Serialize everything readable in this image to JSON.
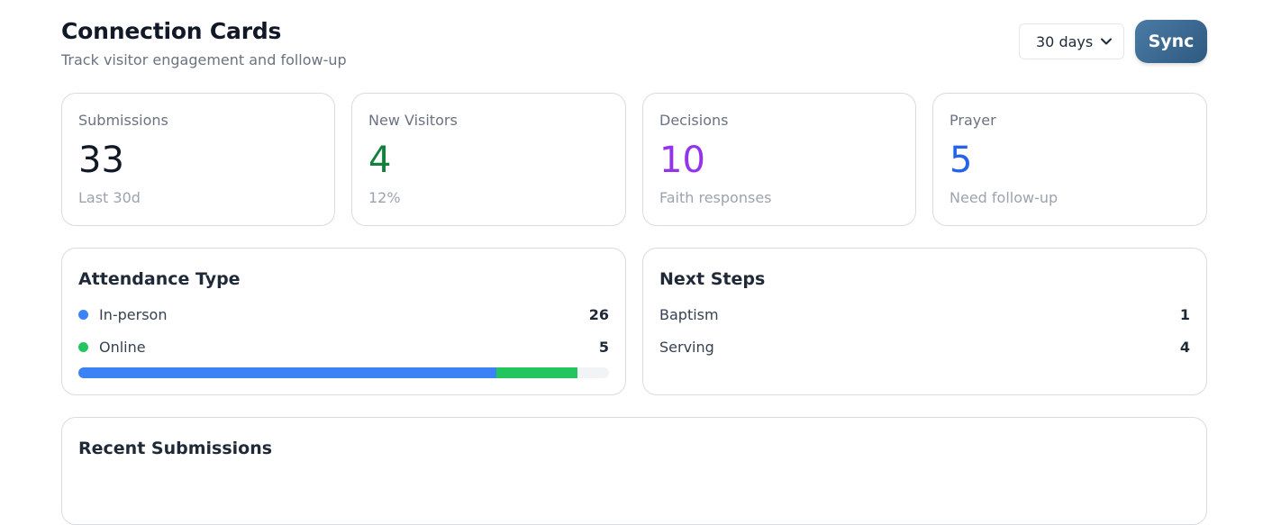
{
  "header": {
    "title": "Connection Cards",
    "subtitle": "Track visitor engagement and follow-up",
    "range_value": "30 days",
    "sync_label": "Sync"
  },
  "stats": [
    {
      "label": "Submissions",
      "value": "33",
      "note": "Last 30d",
      "color": "#111827"
    },
    {
      "label": "New Visitors",
      "value": "4",
      "note": "12%",
      "color": "#15803d"
    },
    {
      "label": "Decisions",
      "value": "10",
      "note": "Faith responses",
      "color": "#9333ea"
    },
    {
      "label": "Prayer",
      "value": "5",
      "note": "Need follow-up",
      "color": "#2563eb"
    }
  ],
  "attendance": {
    "title": "Attendance Type",
    "items": [
      {
        "name": "In-person",
        "count": "26",
        "color": "#3b82f6"
      },
      {
        "name": "Online",
        "count": "5",
        "color": "#22c55e"
      }
    ],
    "bar": {
      "in_person_pct": 78.8,
      "online_pct": 15.2
    }
  },
  "next_steps": {
    "title": "Next Steps",
    "items": [
      {
        "name": "Baptism",
        "count": "1"
      },
      {
        "name": "Serving",
        "count": "4"
      }
    ]
  },
  "recent": {
    "title": "Recent Submissions"
  }
}
